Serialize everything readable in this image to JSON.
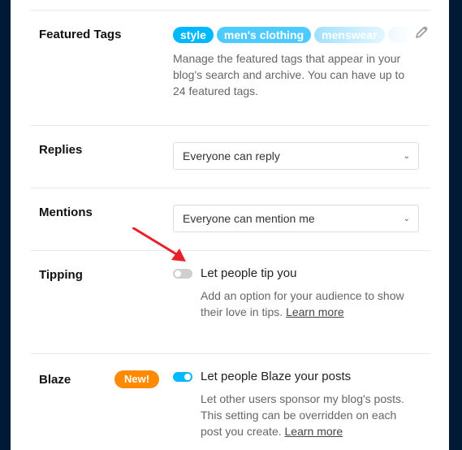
{
  "featured_tags": {
    "label": "Featured Tags",
    "tags": [
      {
        "text": "style",
        "color": "#00b8ff"
      },
      {
        "text": "men's clothing",
        "color": "#4dcbff"
      },
      {
        "text": "menswear",
        "color": "#a6e4ff"
      }
    ],
    "edit_icon": "pencil-icon",
    "description": "Manage the featured tags that appear in your blog's search and archive. You can have up to 24 featured tags."
  },
  "replies": {
    "label": "Replies",
    "selected": "Everyone can reply"
  },
  "mentions": {
    "label": "Mentions",
    "selected": "Everyone can mention me"
  },
  "tipping": {
    "label": "Tipping",
    "toggle_label": "Let people tip you",
    "enabled": false,
    "description": "Add an option for your audience to show their love in tips.",
    "learn_more": "Learn more"
  },
  "blaze": {
    "label": "Blaze",
    "badge": "New!",
    "toggle_label": "Let people Blaze your posts",
    "enabled": true,
    "description": "Let other users sponsor my blog's posts. This setting can be overridden on each post you create.",
    "learn_more": "Learn more"
  },
  "colors": {
    "background": "#001935",
    "accent": "#00b8ff",
    "badge": "#ff8a00",
    "toggle_off": "#cfcfcf",
    "annotation_arrow": "#e8202a"
  }
}
